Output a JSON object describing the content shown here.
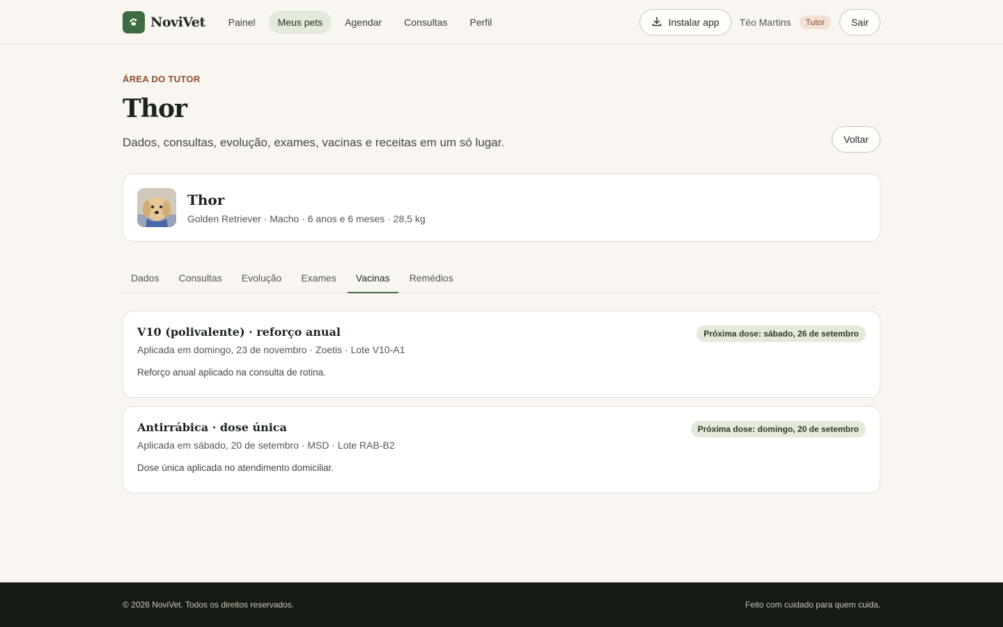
{
  "header": {
    "logo_text": "NoviVet",
    "nav": [
      {
        "label": "Painel",
        "active": false
      },
      {
        "label": "Meus pets",
        "active": true
      },
      {
        "label": "Agendar",
        "active": false
      },
      {
        "label": "Consultas",
        "active": false
      },
      {
        "label": "Perfil",
        "active": false
      }
    ],
    "install_label": "Instalar app",
    "user_name": "Téo Martins",
    "role": "Tutor",
    "logout_label": "Sair"
  },
  "page": {
    "eyebrow": "ÁREA DO TUTOR",
    "title": "Thor",
    "subtitle": "Dados, consultas, evolução, exames, vacinas e receitas em um só lugar.",
    "back_label": "Voltar"
  },
  "pet": {
    "name": "Thor",
    "meta": "Golden Retriever · Macho · 6 anos e 6 meses · 28,5 kg"
  },
  "tabs": [
    {
      "label": "Dados",
      "active": false
    },
    {
      "label": "Consultas",
      "active": false
    },
    {
      "label": "Evolução",
      "active": false
    },
    {
      "label": "Exames",
      "active": false
    },
    {
      "label": "Vacinas",
      "active": true
    },
    {
      "label": "Remédios",
      "active": false
    }
  ],
  "vaccines": [
    {
      "name": "V10 (polivalente) · reforço anual",
      "meta": "Aplicada em domingo, 23 de novembro · Zoetis · Lote V10-A1",
      "note": "Reforço anual aplicado na consulta de rotina.",
      "next_dose": "Próxima dose: sábado, 26 de setembro"
    },
    {
      "name": "Antirrábica · dose única",
      "meta": "Aplicada em sábado, 20 de setembro · MSD · Lote RAB-B2",
      "note": "Dose única aplicada no atendimento domiciliar.",
      "next_dose": "Próxima dose: domingo, 20 de setembro"
    }
  ],
  "footer": {
    "copyright": "© 2026 NoviVet. Todos os direitos reservados.",
    "tagline": "Feito com cuidado para quem cuida."
  },
  "colors": {
    "brand": "#3f6b43",
    "accent": "#8a4b2a",
    "background": "#f9f6f1",
    "footer": "#141b14"
  },
  "icons": {
    "logo": "paw-icon",
    "install": "download-icon"
  }
}
